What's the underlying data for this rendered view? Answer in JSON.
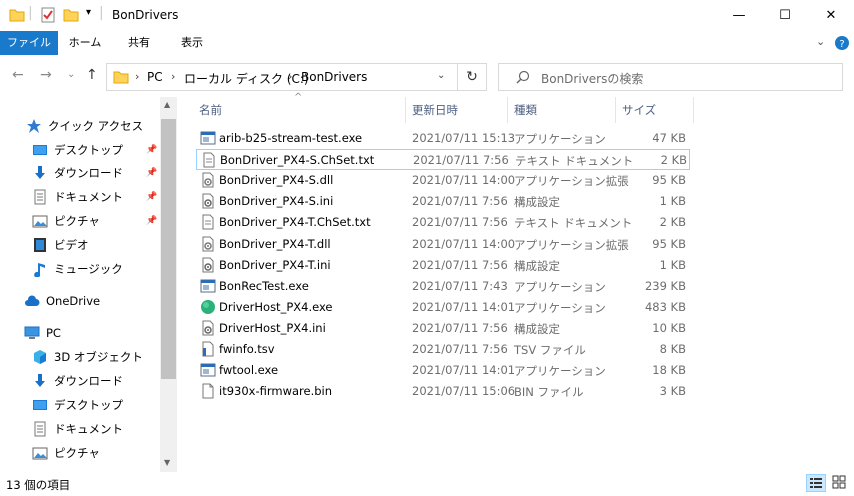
{
  "window": {
    "title": "BonDrivers",
    "minimize": "—",
    "maximize": "☐",
    "close": "✕"
  },
  "ribbon": {
    "tabs": [
      "ファイル",
      "ホーム",
      "共有",
      "表示"
    ]
  },
  "address": {
    "crumbs": [
      "PC",
      "ローカル ディスク (C:)",
      "BonDrivers"
    ]
  },
  "search": {
    "placeholder": "BonDriversの検索"
  },
  "nav": {
    "items": [
      {
        "label": "クイック アクセス",
        "icon": "star-icon"
      },
      {
        "label": "デスクトップ",
        "icon": "desktop-icon",
        "pinned": true
      },
      {
        "label": "ダウンロード",
        "icon": "download-icon",
        "pinned": true
      },
      {
        "label": "ドキュメント",
        "icon": "document-icon",
        "pinned": true
      },
      {
        "label": "ピクチャ",
        "icon": "pictures-icon",
        "pinned": true
      },
      {
        "label": "ビデオ",
        "icon": "video-icon"
      },
      {
        "label": "ミュージック",
        "icon": "music-icon"
      },
      {
        "label": "OneDrive",
        "icon": "cloud-icon"
      },
      {
        "label": "PC",
        "icon": "pc-icon"
      },
      {
        "label": "3D オブジェクト",
        "icon": "cube-icon"
      },
      {
        "label": "ダウンロード",
        "icon": "download-icon"
      },
      {
        "label": "デスクトップ",
        "icon": "desktop-icon"
      },
      {
        "label": "ドキュメント",
        "icon": "document-icon"
      },
      {
        "label": "ピクチャ",
        "icon": "pictures-icon"
      }
    ]
  },
  "columns": {
    "name": "名前",
    "date": "更新日時",
    "type": "種類",
    "size": "サイズ"
  },
  "files": [
    {
      "name": "arib-b25-stream-test.exe",
      "date": "2021/07/11 15:13",
      "type": "アプリケーション",
      "size": "47 KB",
      "icon": "exe-icon"
    },
    {
      "name": "BonDriver_PX4-S.ChSet.txt",
      "date": "2021/07/11 7:56",
      "type": "テキスト ドキュメント",
      "size": "2 KB",
      "icon": "text-file-icon"
    },
    {
      "name": "BonDriver_PX4-S.dll",
      "date": "2021/07/11 14:00",
      "type": "アプリケーション拡張",
      "size": "95 KB",
      "icon": "dll-icon"
    },
    {
      "name": "BonDriver_PX4-S.ini",
      "date": "2021/07/11 7:56",
      "type": "構成設定",
      "size": "1 KB",
      "icon": "ini-icon"
    },
    {
      "name": "BonDriver_PX4-T.ChSet.txt",
      "date": "2021/07/11 7:56",
      "type": "テキスト ドキュメント",
      "size": "2 KB",
      "icon": "text-file-icon"
    },
    {
      "name": "BonDriver_PX4-T.dll",
      "date": "2021/07/11 14:00",
      "type": "アプリケーション拡張",
      "size": "95 KB",
      "icon": "dll-icon"
    },
    {
      "name": "BonDriver_PX4-T.ini",
      "date": "2021/07/11 7:56",
      "type": "構成設定",
      "size": "1 KB",
      "icon": "ini-icon"
    },
    {
      "name": "BonRecTest.exe",
      "date": "2021/07/11 7:43",
      "type": "アプリケーション",
      "size": "239 KB",
      "icon": "exe-icon"
    },
    {
      "name": "DriverHost_PX4.exe",
      "date": "2021/07/11 14:01",
      "type": "アプリケーション",
      "size": "483 KB",
      "icon": "globe-icon"
    },
    {
      "name": "DriverHost_PX4.ini",
      "date": "2021/07/11 7:56",
      "type": "構成設定",
      "size": "10 KB",
      "icon": "ini-icon"
    },
    {
      "name": "fwinfo.tsv",
      "date": "2021/07/11 7:56",
      "type": "TSV ファイル",
      "size": "8 KB",
      "icon": "tsv-icon"
    },
    {
      "name": "fwtool.exe",
      "date": "2021/07/11 14:01",
      "type": "アプリケーション",
      "size": "18 KB",
      "icon": "exe-icon"
    },
    {
      "name": "it930x-firmware.bin",
      "date": "2021/07/11 15:06",
      "type": "BIN ファイル",
      "size": "3 KB",
      "icon": "blank-file-icon"
    }
  ],
  "status": {
    "count": "13 個の項目"
  },
  "colors": {
    "accent": "#1979ca",
    "selection_border": "#99d1ff",
    "header_text": "#4d6082",
    "muted_text": "#6d6d6d"
  }
}
